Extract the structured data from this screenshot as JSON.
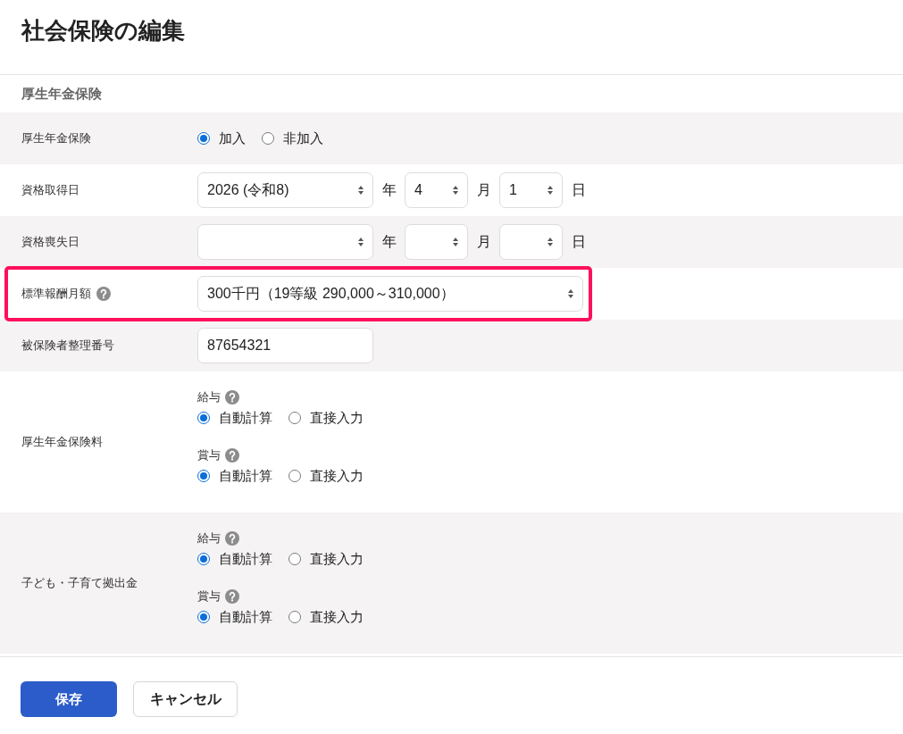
{
  "title": "社会保険の編集",
  "section": {
    "title": "厚生年金保険",
    "rows": [
      {
        "kind": "radio",
        "label": "厚生年金保険",
        "options": [
          {
            "label": "加入",
            "selected": true
          },
          {
            "label": "非加入",
            "selected": false
          }
        ]
      },
      {
        "kind": "date",
        "label": "資格取得日",
        "fields": [
          {
            "value": "2026 (令和8)",
            "unit": "年"
          },
          {
            "value": "4",
            "unit": "月"
          },
          {
            "value": "1",
            "unit": "日"
          }
        ]
      },
      {
        "kind": "date",
        "label": "資格喪失日",
        "fields": [
          {
            "unit": "年"
          },
          {
            "unit": "月"
          },
          {
            "unit": "日"
          }
        ]
      },
      {
        "kind": "select",
        "label": "標準報酬月額",
        "help": true,
        "highlighted": true,
        "value": "300千円（19等級 290,000～310,000）"
      },
      {
        "kind": "input",
        "label": "被保険者整理番号",
        "value": "87654321"
      },
      {
        "kind": "groups",
        "label": "厚生年金保険料",
        "groups": [
          {
            "label": "給与",
            "help": true,
            "options": [
              {
                "label": "自動計算",
                "selected": true
              },
              {
                "label": "直接入力",
                "selected": false
              }
            ]
          },
          {
            "label": "賞与",
            "help": true,
            "options": [
              {
                "label": "自動計算",
                "selected": true
              },
              {
                "label": "直接入力",
                "selected": false
              }
            ]
          }
        ]
      },
      {
        "kind": "groups",
        "label": "子ども・子育て拠出金",
        "groups": [
          {
            "label": "給与",
            "help": true,
            "options": [
              {
                "label": "自動計算",
                "selected": true
              },
              {
                "label": "直接入力",
                "selected": false
              }
            ]
          },
          {
            "label": "賞与",
            "help": true,
            "options": [
              {
                "label": "自動計算",
                "selected": true
              },
              {
                "label": "直接入力",
                "selected": false
              }
            ]
          }
        ]
      }
    ]
  },
  "footer": {
    "buttons": [
      {
        "label": "保存",
        "kind": "primary"
      },
      {
        "label": "キャンセル",
        "kind": "secondary"
      }
    ]
  }
}
